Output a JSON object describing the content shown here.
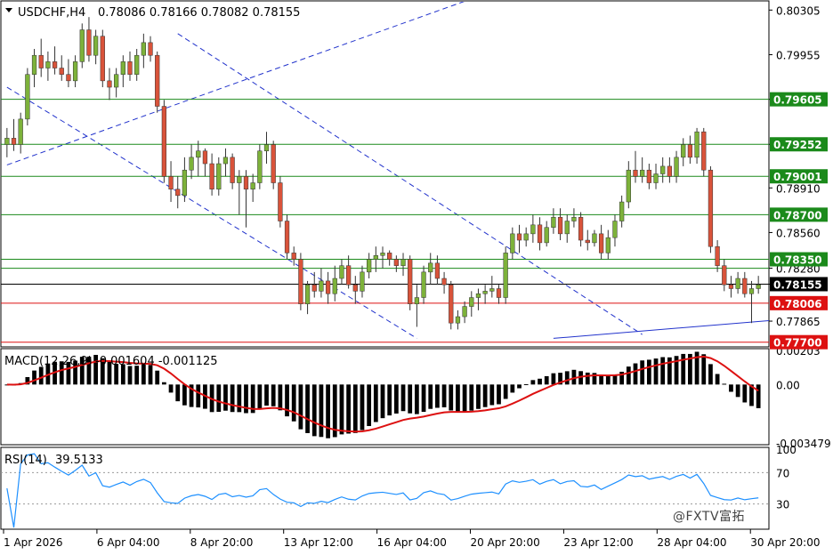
{
  "header": {
    "symbol": "USDCHF,H4",
    "ohlc": "0.78086 0.78166 0.78082 0.78155"
  },
  "macd": {
    "label": "MACD(12,26,9)",
    "values": "-0.001604 -0.001125"
  },
  "rsi": {
    "label": "RSI(14)",
    "value": "39.5133"
  },
  "watermark": "@FXTV富拓",
  "chart_data": [
    {
      "type": "candlestick",
      "price_range": [
        0.7767,
        0.8037
      ],
      "price_ticks": [
        "0.80305",
        "0.79955",
        "0.79605",
        "0.79252",
        "0.78910",
        "0.78560",
        "0.78280",
        "0.78155",
        "0.77865"
      ],
      "x_labels": [
        "1 Apr 2026",
        "6 Apr 04:00",
        "8 Apr 20:00",
        "13 Apr 12:00",
        "16 Apr 04:00",
        "20 Apr 20:00",
        "23 Apr 12:00",
        "28 Apr 04:00",
        "30 Apr 20:00"
      ],
      "level_lines": [
        {
          "value": 0.79605,
          "label": "0.79605",
          "color": "#1b8a1b"
        },
        {
          "value": 0.79252,
          "label": "0.79252",
          "color": "#1b8a1b"
        },
        {
          "value": 0.79001,
          "label": "0.79001",
          "color": "#1b8a1b"
        },
        {
          "value": 0.787,
          "label": "0.78700",
          "color": "#1b8a1b"
        },
        {
          "value": 0.7835,
          "label": "0.78350",
          "color": "#1b8a1b"
        },
        {
          "value": 0.7828,
          "label": "",
          "color": "#1b8a1b"
        },
        {
          "value": 0.78155,
          "label": "0.78155",
          "color": "#000000"
        },
        {
          "value": 0.78006,
          "label": "0.78006",
          "color": "#dd1111"
        },
        {
          "value": 0.777,
          "label": "0.77700",
          "color": "#dd1111"
        }
      ],
      "trend_lines": [
        {
          "from": [
            0,
            0.7909
          ],
          "to": [
            72,
            0.8047
          ],
          "style": "dashed",
          "color": "#2233cc"
        },
        {
          "from": [
            0,
            0.797
          ],
          "to": [
            60,
            0.7773
          ],
          "style": "dashed",
          "color": "#2233cc"
        },
        {
          "from": [
            25,
            0.8012
          ],
          "to": [
            93,
            0.7776
          ],
          "style": "dashed",
          "color": "#2233cc"
        },
        {
          "from": [
            80,
            0.7773
          ],
          "to": [
            130,
            0.7795
          ],
          "style": "solid",
          "color": "#2233cc"
        }
      ],
      "candles": [
        [
          0.7925,
          0.7938,
          0.7915,
          0.793
        ],
        [
          0.793,
          0.7945,
          0.792,
          0.7925
        ],
        [
          0.7925,
          0.795,
          0.7918,
          0.7945
        ],
        [
          0.7945,
          0.7985,
          0.794,
          0.798
        ],
        [
          0.798,
          0.8,
          0.797,
          0.7995
        ],
        [
          0.7995,
          0.8008,
          0.7978,
          0.7985
        ],
        [
          0.7985,
          0.7998,
          0.7975,
          0.799
        ],
        [
          0.799,
          0.8002,
          0.798,
          0.7985
        ],
        [
          0.7985,
          0.7995,
          0.7975,
          0.798
        ],
        [
          0.798,
          0.7992,
          0.797,
          0.7975
        ],
        [
          0.7975,
          0.7995,
          0.797,
          0.799
        ],
        [
          0.799,
          0.802,
          0.7985,
          0.8015
        ],
        [
          0.8015,
          0.8025,
          0.799,
          0.7995
        ],
        [
          0.7995,
          0.8015,
          0.7988,
          0.801
        ],
        [
          0.801,
          0.8015,
          0.797,
          0.7975
        ],
        [
          0.7975,
          0.7985,
          0.796,
          0.797
        ],
        [
          0.797,
          0.7985,
          0.7962,
          0.798
        ],
        [
          0.798,
          0.7995,
          0.797,
          0.799
        ],
        [
          0.799,
          0.7998,
          0.7975,
          0.798
        ],
        [
          0.798,
          0.8,
          0.7975,
          0.7995
        ],
        [
          0.7995,
          0.8012,
          0.7985,
          0.8005
        ],
        [
          0.8005,
          0.801,
          0.799,
          0.7995
        ],
        [
          0.7995,
          0.7998,
          0.795,
          0.7955
        ],
        [
          0.7955,
          0.796,
          0.7895,
          0.79
        ],
        [
          0.79,
          0.7912,
          0.788,
          0.789
        ],
        [
          0.789,
          0.79,
          0.7875,
          0.7885
        ],
        [
          0.7885,
          0.7915,
          0.788,
          0.7905
        ],
        [
          0.7905,
          0.7925,
          0.7898,
          0.7915
        ],
        [
          0.7915,
          0.7928,
          0.79,
          0.792
        ],
        [
          0.792,
          0.7922,
          0.79,
          0.791
        ],
        [
          0.791,
          0.7918,
          0.7885,
          0.789
        ],
        [
          0.789,
          0.7915,
          0.7885,
          0.791
        ],
        [
          0.791,
          0.7922,
          0.79,
          0.7915
        ],
        [
          0.7915,
          0.7918,
          0.789,
          0.7895
        ],
        [
          0.7895,
          0.7905,
          0.787,
          0.79
        ],
        [
          0.79,
          0.7905,
          0.786,
          0.789
        ],
        [
          0.789,
          0.7902,
          0.788,
          0.7895
        ],
        [
          0.7895,
          0.7925,
          0.789,
          0.792
        ],
        [
          0.792,
          0.7935,
          0.791,
          0.7925
        ],
        [
          0.7925,
          0.7928,
          0.789,
          0.7895
        ],
        [
          0.7895,
          0.79,
          0.786,
          0.7865
        ],
        [
          0.7865,
          0.787,
          0.7835,
          0.784
        ],
        [
          0.784,
          0.7845,
          0.783,
          0.7835
        ],
        [
          0.7835,
          0.784,
          0.7795,
          0.78
        ],
        [
          0.78,
          0.7818,
          0.7792,
          0.7815
        ],
        [
          0.7815,
          0.7825,
          0.7805,
          0.781
        ],
        [
          0.781,
          0.7828,
          0.7805,
          0.7818
        ],
        [
          0.7818,
          0.7825,
          0.78,
          0.7808
        ],
        [
          0.7808,
          0.783,
          0.7802,
          0.782
        ],
        [
          0.782,
          0.7835,
          0.7815,
          0.783
        ],
        [
          0.783,
          0.7838,
          0.7812,
          0.7815
        ],
        [
          0.7815,
          0.7822,
          0.78,
          0.781
        ],
        [
          0.781,
          0.783,
          0.7805,
          0.7825
        ],
        [
          0.7825,
          0.784,
          0.782,
          0.7835
        ],
        [
          0.7835,
          0.7845,
          0.7825,
          0.7838
        ],
        [
          0.7838,
          0.7845,
          0.7828,
          0.784
        ],
        [
          0.784,
          0.7842,
          0.783,
          0.7835
        ],
        [
          0.7835,
          0.7838,
          0.7825,
          0.783
        ],
        [
          0.783,
          0.784,
          0.7822,
          0.7835
        ],
        [
          0.7835,
          0.7838,
          0.7795,
          0.78
        ],
        [
          0.78,
          0.7815,
          0.7782,
          0.7805
        ],
        [
          0.7805,
          0.783,
          0.78,
          0.7825
        ],
        [
          0.7825,
          0.784,
          0.7815,
          0.7832
        ],
        [
          0.7832,
          0.7838,
          0.7815,
          0.782
        ],
        [
          0.782,
          0.7825,
          0.7808,
          0.7815
        ],
        [
          0.7815,
          0.7818,
          0.778,
          0.7785
        ],
        [
          0.7785,
          0.7795,
          0.778,
          0.779
        ],
        [
          0.779,
          0.7802,
          0.7785,
          0.7798
        ],
        [
          0.7798,
          0.781,
          0.779,
          0.7805
        ],
        [
          0.7805,
          0.7812,
          0.7795,
          0.7808
        ],
        [
          0.7808,
          0.7815,
          0.78,
          0.781
        ],
        [
          0.781,
          0.7822,
          0.7805,
          0.7812
        ],
        [
          0.7812,
          0.7815,
          0.78,
          0.7805
        ],
        [
          0.7805,
          0.7845,
          0.78,
          0.784
        ],
        [
          0.784,
          0.786,
          0.7835,
          0.7855
        ],
        [
          0.7855,
          0.7862,
          0.784,
          0.785
        ],
        [
          0.785,
          0.786,
          0.7845,
          0.7855
        ],
        [
          0.7855,
          0.787,
          0.7848,
          0.7862
        ],
        [
          0.7862,
          0.7868,
          0.7842,
          0.7848
        ],
        [
          0.7848,
          0.7865,
          0.7845,
          0.786
        ],
        [
          0.786,
          0.7875,
          0.7855,
          0.7868
        ],
        [
          0.7868,
          0.7875,
          0.785,
          0.7855
        ],
        [
          0.7855,
          0.787,
          0.7848,
          0.7865
        ],
        [
          0.7865,
          0.7875,
          0.786,
          0.7868
        ],
        [
          0.7868,
          0.7872,
          0.7845,
          0.785
        ],
        [
          0.785,
          0.7858,
          0.7842,
          0.7848
        ],
        [
          0.7848,
          0.7858,
          0.7845,
          0.7855
        ],
        [
          0.7855,
          0.7862,
          0.7835,
          0.784
        ],
        [
          0.784,
          0.7858,
          0.7835,
          0.7852
        ],
        [
          0.7852,
          0.787,
          0.7845,
          0.7865
        ],
        [
          0.7865,
          0.7885,
          0.786,
          0.788
        ],
        [
          0.788,
          0.7912,
          0.7875,
          0.7905
        ],
        [
          0.7905,
          0.792,
          0.7895,
          0.79
        ],
        [
          0.79,
          0.7915,
          0.7895,
          0.7905
        ],
        [
          0.7905,
          0.791,
          0.789,
          0.7895
        ],
        [
          0.7895,
          0.791,
          0.789,
          0.7902
        ],
        [
          0.7902,
          0.7915,
          0.7895,
          0.7908
        ],
        [
          0.7908,
          0.7915,
          0.7895,
          0.79
        ],
        [
          0.79,
          0.792,
          0.7895,
          0.7915
        ],
        [
          0.7915,
          0.793,
          0.7908,
          0.7925
        ],
        [
          0.7925,
          0.7932,
          0.791,
          0.7915
        ],
        [
          0.7915,
          0.7938,
          0.791,
          0.7935
        ],
        [
          0.7935,
          0.7938,
          0.79,
          0.7905
        ],
        [
          0.7905,
          0.7908,
          0.784,
          0.7845
        ],
        [
          0.7845,
          0.785,
          0.7825,
          0.783
        ],
        [
          0.783,
          0.7835,
          0.781,
          0.7815
        ],
        [
          0.7815,
          0.7822,
          0.7805,
          0.7812
        ],
        [
          0.7812,
          0.7825,
          0.7808,
          0.782
        ],
        [
          0.782,
          0.7825,
          0.7805,
          0.7808
        ],
        [
          0.7808,
          0.7818,
          0.7785,
          0.7812
        ],
        [
          0.7812,
          0.7822,
          0.7808,
          0.7815
        ]
      ]
    },
    {
      "type": "histogram+line",
      "name": "MACD(12,26,9)",
      "range": [
        -0.003479,
        0.00203
      ],
      "ticks": [
        "0.00203",
        "0.00",
        "-0.003479"
      ]
    },
    {
      "type": "line",
      "name": "RSI(14)",
      "range": [
        0,
        100
      ],
      "ticks": [
        "100",
        "70",
        "30",
        "0"
      ],
      "levels": [
        70,
        30
      ]
    }
  ]
}
